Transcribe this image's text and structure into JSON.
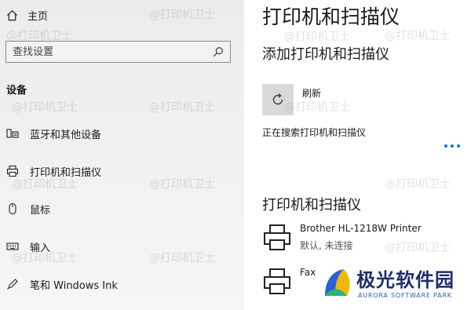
{
  "sidebar": {
    "home_label": "主页",
    "search_placeholder": "查找设置",
    "section_title": "设备",
    "items": [
      {
        "label": "蓝牙和其他设备",
        "icon": "keyboard-phone-icon"
      },
      {
        "label": "打印机和扫描仪",
        "icon": "printer-icon"
      },
      {
        "label": "鼠标",
        "icon": "mouse-icon"
      },
      {
        "label": "输入",
        "icon": "keyboard-icon"
      },
      {
        "label": "笔和 Windows Ink",
        "icon": "pen-icon"
      }
    ]
  },
  "main": {
    "page_title": "打印机和扫描仪",
    "add_heading": "添加打印机和扫描仪",
    "refresh_label": "刷新",
    "searching_text": "正在搜索打印机和扫描仪",
    "list_heading": "打印机和扫描仪",
    "printers": [
      {
        "name": "Brother HL-1218W Printer",
        "status": "默认, 未连接"
      },
      {
        "name": "Fax",
        "status": ""
      }
    ]
  },
  "watermark": "@打印机卫士",
  "brand": {
    "name_cn": "极光软件园",
    "name_en": "AURORA SOFTWARE PARK"
  },
  "colors": {
    "accent": "#1a73c8",
    "sidebar_bg": "#efefef",
    "brand": "#1f2d6b"
  }
}
